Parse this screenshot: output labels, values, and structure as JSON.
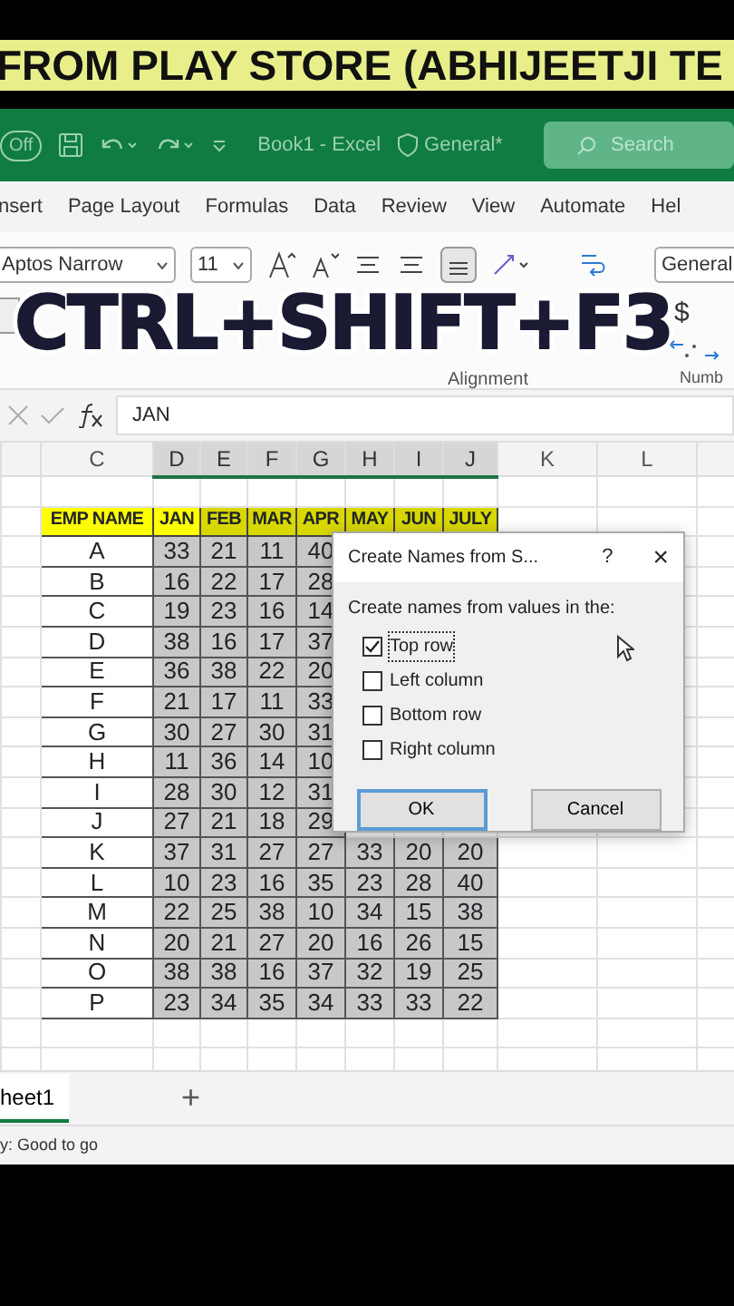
{
  "banner": {
    "text": "FROM PLAY STORE (ABHIJEETJI TE"
  },
  "title_bar": {
    "autosave": "Off",
    "document": "Book1 - Excel",
    "sensitivity": "General*",
    "search": {
      "placeholder": "Search"
    }
  },
  "ribbon_tabs": [
    "nsert",
    "Page Layout",
    "Formulas",
    "Data",
    "Review",
    "View",
    "Automate",
    "Hel"
  ],
  "ribbon": {
    "font_name": "Aptos Narrow",
    "font_size": "11",
    "number_format": "General",
    "currency": "$",
    "group_labels": [
      "Alignment",
      "Numb"
    ]
  },
  "overlay": {
    "text": "CTRL+SHIFT+F3"
  },
  "formula_bar": {
    "value": "JAN"
  },
  "sheet": {
    "columns": [
      "C",
      "D",
      "E",
      "F",
      "G",
      "H",
      "I",
      "J",
      "K",
      "L"
    ],
    "header": [
      "EMP NAME",
      "JAN",
      "FEB",
      "MAR",
      "APR",
      "MAY",
      "JUN",
      "JULY"
    ],
    "rows": [
      {
        "name": "A",
        "values": [
          "33",
          "21",
          "11",
          "40"
        ]
      },
      {
        "name": "B",
        "values": [
          "16",
          "22",
          "17",
          "28"
        ]
      },
      {
        "name": "C",
        "values": [
          "19",
          "23",
          "16",
          "14"
        ]
      },
      {
        "name": "D",
        "values": [
          "38",
          "16",
          "17",
          "37"
        ]
      },
      {
        "name": "E",
        "values": [
          "36",
          "38",
          "22",
          "20"
        ]
      },
      {
        "name": "F",
        "values": [
          "21",
          "17",
          "11",
          "33"
        ]
      },
      {
        "name": "G",
        "values": [
          "30",
          "27",
          "30",
          "31"
        ]
      },
      {
        "name": "H",
        "values": [
          "11",
          "36",
          "14",
          "10"
        ]
      },
      {
        "name": "I",
        "values": [
          "28",
          "30",
          "12",
          "31"
        ]
      },
      {
        "name": "J",
        "values": [
          "27",
          "21",
          "18",
          "29"
        ]
      },
      {
        "name": "K",
        "values": [
          "37",
          "31",
          "27",
          "27",
          "33",
          "20",
          "20"
        ]
      },
      {
        "name": "L",
        "values": [
          "10",
          "23",
          "16",
          "35",
          "23",
          "28",
          "40"
        ]
      },
      {
        "name": "M",
        "values": [
          "22",
          "25",
          "38",
          "10",
          "34",
          "15",
          "38"
        ]
      },
      {
        "name": "N",
        "values": [
          "20",
          "21",
          "27",
          "20",
          "16",
          "26",
          "15"
        ]
      },
      {
        "name": "O",
        "values": [
          "38",
          "38",
          "16",
          "37",
          "32",
          "19",
          "25"
        ]
      },
      {
        "name": "P",
        "values": [
          "23",
          "34",
          "35",
          "34",
          "33",
          "33",
          "22"
        ]
      }
    ]
  },
  "dialog": {
    "title": "Create Names from S...",
    "help": "?",
    "close": "×",
    "prompt": "Create names from values in the:",
    "options": [
      {
        "label": "Top row",
        "checked": true
      },
      {
        "label": "Left column",
        "checked": false
      },
      {
        "label": "Bottom row",
        "checked": false
      },
      {
        "label": "Right column",
        "checked": false
      }
    ],
    "buttons": [
      "OK",
      "Cancel"
    ]
  },
  "sheet_tabs": [
    {
      "label": "heet1",
      "selected": true
    }
  ],
  "add_sheet": "+",
  "status_bar": "y: Good to go"
}
